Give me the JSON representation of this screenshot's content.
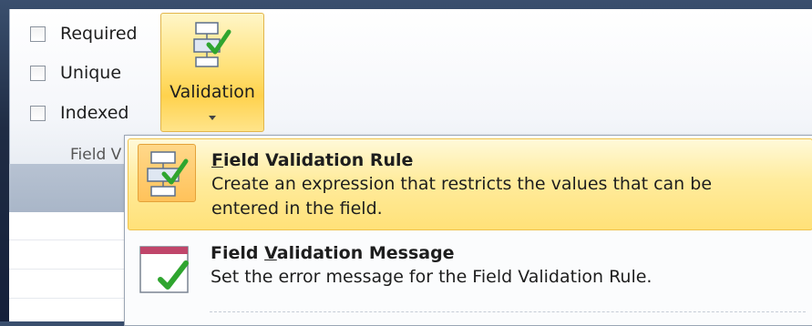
{
  "ribbon": {
    "checkboxes": [
      {
        "label": "Required",
        "checked": false
      },
      {
        "label": "Unique",
        "checked": false
      },
      {
        "label": "Indexed",
        "checked": false
      }
    ],
    "validation_button": {
      "label": "Validation"
    },
    "group_label": "Field V"
  },
  "menu": {
    "items": [
      {
        "title_pre": "",
        "title_accel": "F",
        "title_post": "ield Validation Rule",
        "description": "Create an expression that restricts the values that can be entered in the field.",
        "icon": "validation-rule-icon",
        "selected": true
      },
      {
        "title_pre": "Field ",
        "title_accel": "V",
        "title_post": "alidation Message",
        "description": "Set the error message for the Field Validation Rule.",
        "icon": "validation-message-icon",
        "selected": false
      }
    ]
  },
  "colors": {
    "highlight": "#ffe178",
    "checkmark": "#2fa52f",
    "background": "#1f2c44"
  }
}
